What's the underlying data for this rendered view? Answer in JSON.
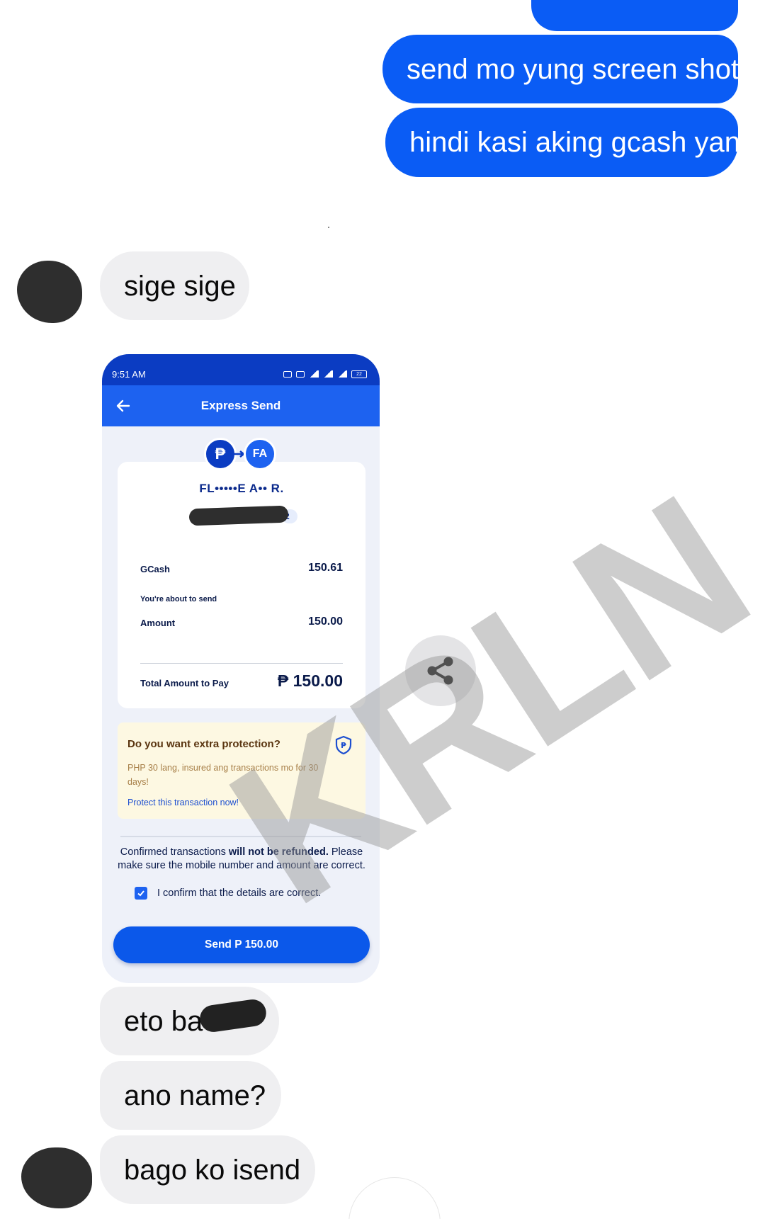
{
  "chat": {
    "messages_out": [
      {
        "text": "send mo yung screen shot"
      },
      {
        "text": "hindi kasi aking gcash yan"
      }
    ],
    "messages_in": [
      {
        "text": "sige sige"
      },
      {
        "text": "eto ba"
      },
      {
        "text": "ano name?"
      },
      {
        "text": "bago ko isend"
      }
    ]
  },
  "watermark": "KRLN",
  "screenshot": {
    "status_time": "9:51 AM",
    "status_battery": "22",
    "header_title": "Express Send",
    "badge_peso": "₱",
    "badge_initials": "FA",
    "recipient_name": "FL•••••E A•• R.",
    "redacted_number_tail": "2",
    "gcash_label": "GCash",
    "gcash_balance": "150.61",
    "about_to_send": "You're about to send",
    "amount_label": "Amount",
    "amount_value": "150.00",
    "total_label": "Total Amount to Pay",
    "total_value": "₱ 150.00",
    "protect_title": "Do you want extra protection?",
    "protect_body": "PHP 30 lang, insured ang transactions mo for 30 days!",
    "protect_link": "Protect this transaction now!",
    "notice_bold_1": "Confirmed transactions",
    "notice_bold_2": "will not be refunded.",
    "notice_rest": "Please make sure the mobile number and amount are correct.",
    "confirm_label": "I confirm that the details are correct.",
    "send_button": "Send P 150.00"
  },
  "icons": {
    "back": "arrow-left-icon",
    "share": "share-icon",
    "shield": "shield-peso-icon",
    "check": "checkmark-icon"
  },
  "colors": {
    "outgoing_bubble": "#0a5cf5",
    "incoming_bubble": "#efeff1",
    "gcash_blue": "#1d62f0",
    "gcash_dark": "#0b3cc2"
  }
}
